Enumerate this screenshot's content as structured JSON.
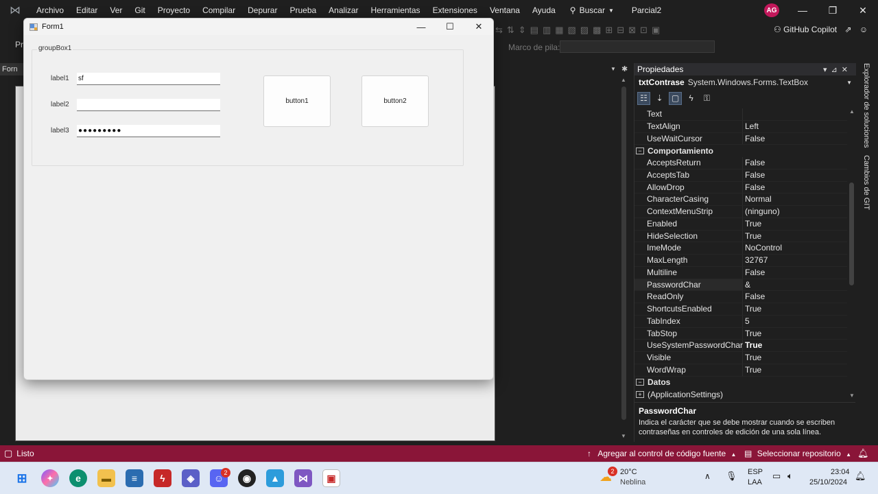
{
  "ide": {
    "menu": [
      "Archivo",
      "Editar",
      "Ver",
      "Git",
      "Proyecto",
      "Compilar",
      "Depurar",
      "Prueba",
      "Analizar",
      "Herramientas",
      "Extensiones",
      "Ventana",
      "Ayuda"
    ],
    "search_label": "Buscar",
    "solution_name": "Parcial2",
    "user_initials": "AG",
    "copilot_label": "GitHub Copilot",
    "stack_label": "Marco de pila:",
    "left_tab_label": "Forn",
    "left_pr_label": "Pr"
  },
  "form": {
    "title": "Form1",
    "groupbox_title": "groupBox1",
    "labels": [
      "label1",
      "label2",
      "label3"
    ],
    "textboxes": [
      "sf",
      "",
      "●●●●●●●●●"
    ],
    "buttons": [
      "button1",
      "button2"
    ]
  },
  "properties": {
    "panel_title": "Propiedades",
    "object_name": "txtContrase",
    "object_type": "System.Windows.Forms.TextBox",
    "rows_top": [
      {
        "name": "Text",
        "value": ""
      },
      {
        "name": "TextAlign",
        "value": "Left"
      },
      {
        "name": "UseWaitCursor",
        "value": "False"
      }
    ],
    "category_behavior": "Comportamiento",
    "rows_behavior": [
      {
        "name": "AcceptsReturn",
        "value": "False"
      },
      {
        "name": "AcceptsTab",
        "value": "False"
      },
      {
        "name": "AllowDrop",
        "value": "False"
      },
      {
        "name": "CharacterCasing",
        "value": "Normal"
      },
      {
        "name": "ContextMenuStrip",
        "value": "(ninguno)"
      },
      {
        "name": "Enabled",
        "value": "True"
      },
      {
        "name": "HideSelection",
        "value": "True"
      },
      {
        "name": "ImeMode",
        "value": "NoControl"
      },
      {
        "name": "MaxLength",
        "value": "32767"
      },
      {
        "name": "Multiline",
        "value": "False"
      },
      {
        "name": "PasswordChar",
        "value": "&"
      },
      {
        "name": "ReadOnly",
        "value": "False"
      },
      {
        "name": "ShortcutsEnabled",
        "value": "True"
      },
      {
        "name": "TabIndex",
        "value": "5"
      },
      {
        "name": "TabStop",
        "value": "True"
      },
      {
        "name": "UseSystemPasswordChar",
        "value": "True"
      },
      {
        "name": "Visible",
        "value": "True"
      },
      {
        "name": "WordWrap",
        "value": "True"
      }
    ],
    "category_data": "Datos",
    "row_appsettings": "(ApplicationSettings)",
    "desc_title": "PasswordChar",
    "desc_text": "Indica el carácter que se debe mostrar cuando se escriben contraseñas en controles de edición de una sola línea."
  },
  "side_tabs": [
    "Explorador de soluciones",
    "Cambios de GIT"
  ],
  "statusbar": {
    "state": "Listo",
    "source_control": "Agregar al control de código fuente",
    "repo": "Seleccionar repositorio"
  },
  "taskbar": {
    "weather_temp": "20°C",
    "weather_desc": "Neblina",
    "weather_badge": "2",
    "lang1": "ESP",
    "lang2": "LAA",
    "time": "23:04",
    "date": "25/10/2024",
    "discord_badge": "2"
  },
  "colors": {
    "status_bar": "#8a1538",
    "accent": "#0078d4"
  }
}
